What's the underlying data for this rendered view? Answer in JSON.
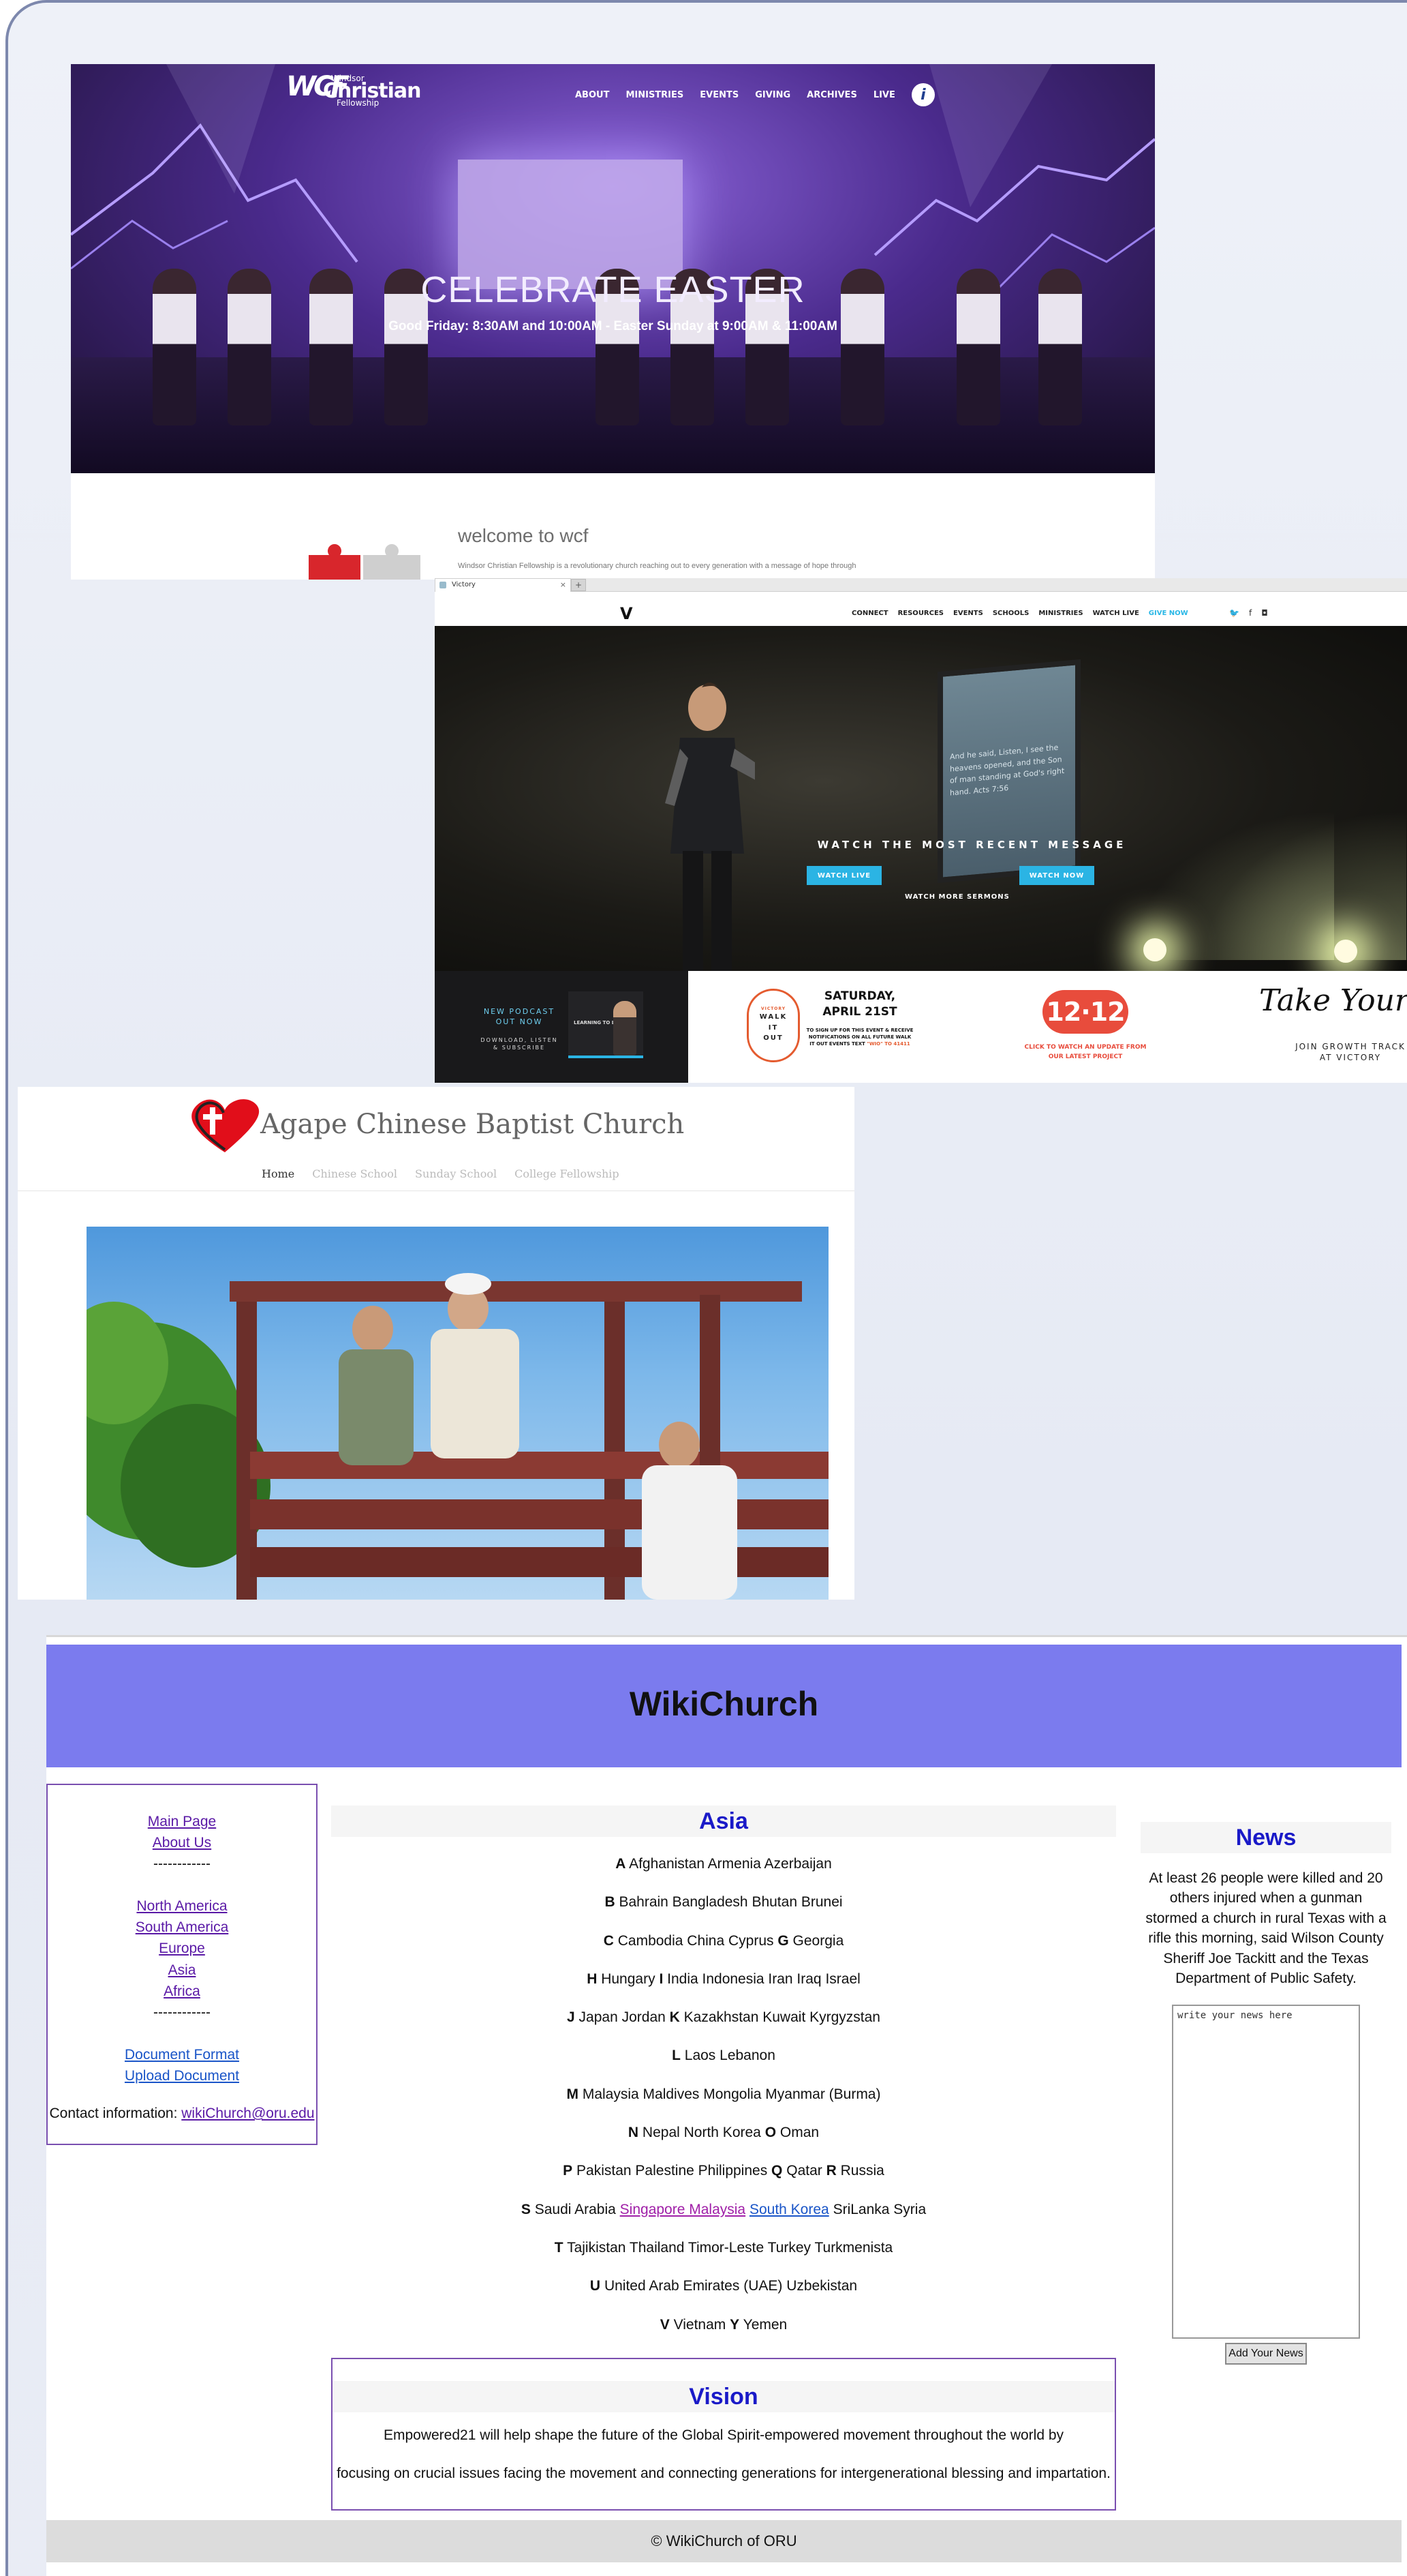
{
  "windsor": {
    "logo": {
      "mark": "WCF",
      "line1": "Windsor",
      "line2": "Christian",
      "line3": "Fellowship"
    },
    "nav": [
      "ABOUT",
      "MINISTRIES",
      "EVENTS",
      "GIVING",
      "ARCHIVES",
      "LIVE"
    ],
    "nav_badge": "i",
    "hero_title": "CELEBRATE EASTER",
    "hero_subtitle": "Good Friday: 8:30AM and 10:00AM - Easter Sunday at 9:00AM & 11:00AM",
    "welcome": "welcome to wcf",
    "welcome_body": "Windsor Christian Fellowship is a revolutionary church reaching out to every generation with a message of hope through"
  },
  "victory": {
    "tab_title": "Victory",
    "tab_close": "×",
    "new_tab": "+",
    "logo": "V",
    "menu": [
      "CONNECT",
      "RESOURCES",
      "EVENTS",
      "SCHOOLS",
      "MINISTRIES",
      "WATCH LIVE",
      "GIVE NOW"
    ],
    "social": [
      "twitter-icon",
      "facebook-icon",
      "instagram-icon"
    ],
    "screen_text": "And he said, Listen, I see the heavens opened, and the Son of man standing at God's right hand. Acts 7:56",
    "hero_heading": "WATCH THE MOST RECENT MESSAGE",
    "btn_live": "WATCH LIVE",
    "btn_now": "WATCH NOW",
    "more": "WATCH MORE SERMONS",
    "podcast_title": "NEW PODCAST OUT NOW",
    "podcast_sub": "DOWNLOAD, LISTEN & SUBSCRIBE",
    "podcast_card": "LEARNING TO LEAD",
    "walk": [
      "WALK",
      "IT",
      "OUT"
    ],
    "walk_small": "VICTORY",
    "sat_date1": "SATURDAY,",
    "sat_date2": "APRIL 21ST",
    "sat_note": "TO SIGN UP FOR THIS EVENT & RECEIVE NOTIFICATIONS ON ALL FUTURE WALK IT OUT EVENTS TEXT",
    "sat_note_code": "\"WIO\" TO 41411",
    "twelve": "12·12",
    "twelve_caption": "CLICK TO WATCH AN UPDATE FROM OUR LATEST PROJECT",
    "script": "Take Your Next Step",
    "join1": "JOIN GROWTH TRACK",
    "join2": "AT VICTORY"
  },
  "agape": {
    "title": "Agape Chinese Baptist Church",
    "nav": [
      "Home",
      "Chinese School",
      "Sunday School",
      "College Fellowship"
    ]
  },
  "wiki": {
    "title": "WikiChurch",
    "sidebar": {
      "main_page": "Main Page",
      "about_us": "About Us",
      "sep": "------------",
      "regions": [
        "North America",
        "South America",
        "Europe",
        "Asia",
        "Africa"
      ],
      "doc_format": "Document Format",
      "upload_doc": "Upload Document",
      "contact_label": "Contact information:",
      "contact_email": "wikiChurch@oru.edu"
    },
    "asia_heading": "Asia",
    "asia_rows": [
      [
        {
          "l": "A"
        },
        {
          "t": "Afghanistan Armenia Azerbaijan"
        }
      ],
      [
        {
          "l": "B"
        },
        {
          "t": "Bahrain Bangladesh Bhutan Brunei"
        }
      ],
      [
        {
          "l": "C"
        },
        {
          "t": "Cambodia China Cyprus"
        },
        {
          "l": "G"
        },
        {
          "t": "Georgia"
        }
      ],
      [
        {
          "l": "H"
        },
        {
          "t": "Hungary"
        },
        {
          "l": "I"
        },
        {
          "t": "India Indonesia Iran Iraq Israel"
        }
      ],
      [
        {
          "l": "J"
        },
        {
          "t": "Japan Jordan"
        },
        {
          "l": "K"
        },
        {
          "t": "Kazakhstan Kuwait Kyrgyzstan"
        }
      ],
      [
        {
          "l": "L"
        },
        {
          "t": "Laos Lebanon"
        }
      ],
      [
        {
          "l": "M"
        },
        {
          "t": "Malaysia Maldives Mongolia Myanmar (Burma)"
        }
      ],
      [
        {
          "l": "N"
        },
        {
          "t": "Nepal North Korea"
        },
        {
          "l": "O"
        },
        {
          "t": "Oman"
        }
      ],
      [
        {
          "l": "P"
        },
        {
          "t": "Pakistan Palestine Philippines"
        },
        {
          "l": "Q"
        },
        {
          "t": "Qatar"
        },
        {
          "l": "R"
        },
        {
          "t": "Russia"
        }
      ],
      [
        {
          "l": "S"
        },
        {
          "t": "Saudi Arabia"
        },
        {
          "lp": "Singapore Malaysia"
        },
        {
          "lb": "South Korea"
        },
        {
          "t": "SriLanka Syria"
        }
      ],
      [
        {
          "l": "T"
        },
        {
          "t": "Tajikistan Thailand Timor-Leste Turkey Turkmenista"
        }
      ],
      [
        {
          "l": "U"
        },
        {
          "t": "United Arab Emirates (UAE) Uzbekistan"
        }
      ],
      [
        {
          "l": "V"
        },
        {
          "t": "Vietnam"
        },
        {
          "l": "Y"
        },
        {
          "t": "Yemen"
        }
      ]
    ],
    "vision_heading": "Vision",
    "vision_line1": "Empowered21 will help shape the future of the Global Spirit-empowered movement throughout the world by",
    "vision_line2": "focusing on crucial issues facing the movement and connecting generations for intergenerational blessing and impartation.",
    "news_heading": "News",
    "news_text": "At least 26 people were killed and 20 others injured when a gunman stormed a church in rural Texas with a rifle this morning, said Wilson County Sheriff Joe Tackitt and the Texas Department of Public Safety.",
    "news_placeholder": "write your news here",
    "news_button": "Add Your News",
    "footer": "© WikiChurch of ORU"
  }
}
